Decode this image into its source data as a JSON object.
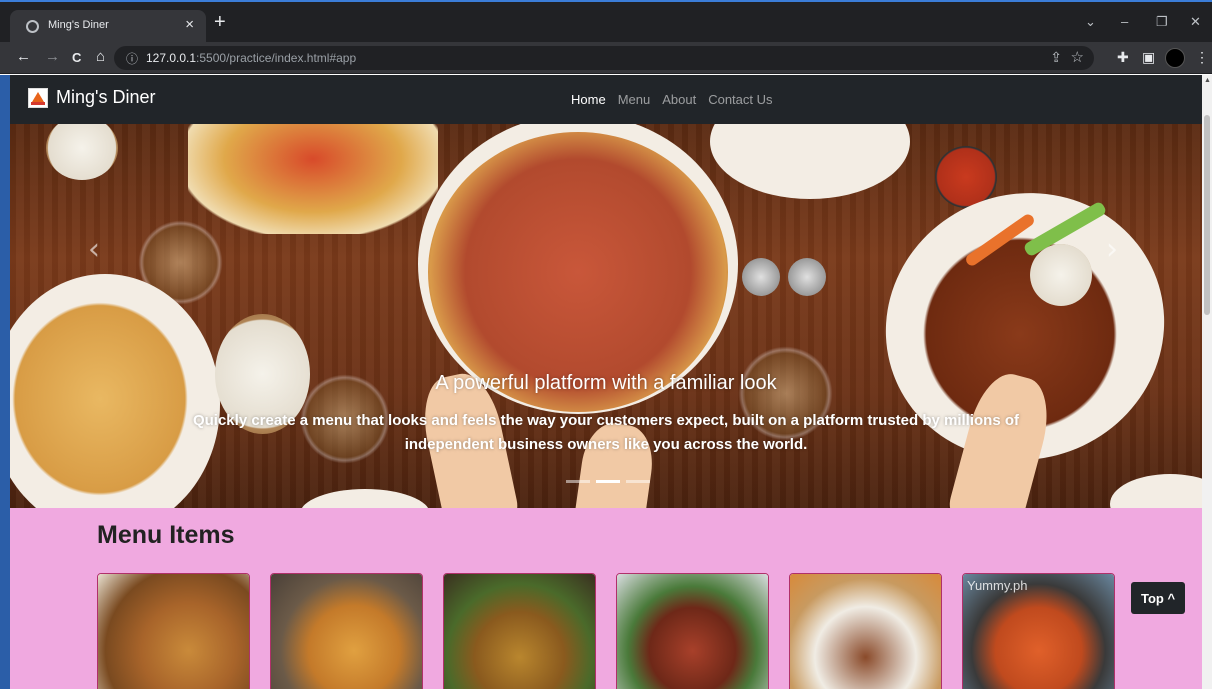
{
  "browser": {
    "tab_title": "Ming's Diner",
    "tab_close": "×",
    "new_tab": "+",
    "url_host": "127.0.0.1",
    "url_rest": ":5500/practice/index.html#app",
    "controls": {
      "chevron": "⌄",
      "minimize": "–",
      "restore": "❐",
      "close": "✕"
    },
    "nav": {
      "back": "←",
      "forward": "→",
      "reload": "C",
      "home": "⌂",
      "info": "ⓘ"
    }
  },
  "site": {
    "brand": "Ming's Diner",
    "nav": [
      {
        "label": "Home",
        "active": true
      },
      {
        "label": "Menu",
        "active": false
      },
      {
        "label": "About",
        "active": false
      },
      {
        "label": "Contact Us",
        "active": false
      }
    ]
  },
  "carousel": {
    "prev": "‹",
    "next": "›",
    "caption_title": "A powerful platform with a familiar look",
    "caption_text": "Quickly create a menu that looks and feels the way your customers expect, built on a platform trusted by millions of independent business owners like you across the world.",
    "slide_count": 3,
    "active_slide": 2
  },
  "menu": {
    "title": "Menu Items",
    "items": [
      {
        "image": "fried-chicken"
      },
      {
        "image": "biryani"
      },
      {
        "image": "falafel"
      },
      {
        "image": "sliced-meat"
      },
      {
        "image": "noodle-bowl"
      },
      {
        "image": "shrimp",
        "watermark": "Yummy.ph"
      }
    ]
  },
  "top_button": "Top ^"
}
